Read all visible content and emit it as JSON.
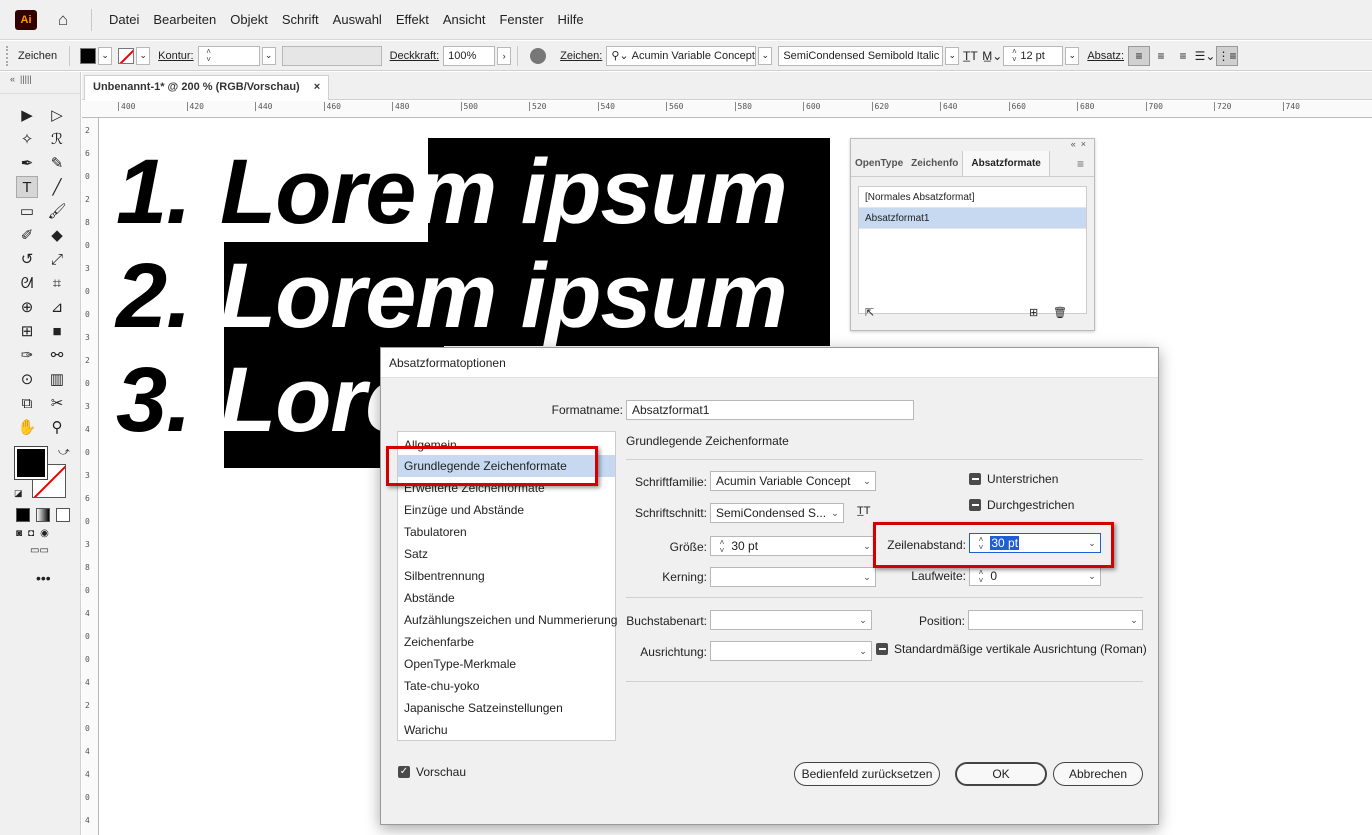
{
  "app": {
    "logo": "Ai",
    "menu": [
      "Datei",
      "Bearbeiten",
      "Objekt",
      "Schrift",
      "Auswahl",
      "Effekt",
      "Ansicht",
      "Fenster",
      "Hilfe"
    ]
  },
  "controlbar": {
    "mode_label": "Zeichen",
    "kontur_label": "Kontur:",
    "deckkraft_label": "Deckkraft:",
    "deckkraft_value": "100%",
    "zeichen_label": "Zeichen:",
    "font_family": "Acumin Variable Concept",
    "font_style": "SemiCondensed Semibold Italic",
    "size_value": "12 pt",
    "absatz_label": "Absatz:"
  },
  "document": {
    "tab_title": "Unbenannt-1* @ 200 % (RGB/Vorschau)",
    "close": "×"
  },
  "ruler": {
    "h_ticks": [
      "400",
      "420",
      "440",
      "460",
      "480",
      "500",
      "520",
      "540",
      "560",
      "580",
      "600",
      "620",
      "640",
      "660",
      "680",
      "700",
      "720",
      "740"
    ],
    "v_ticks": [
      "2",
      "6",
      "0",
      "2",
      "8",
      "0",
      "3",
      "0",
      "0",
      "3",
      "2",
      "0",
      "3",
      "4",
      "0",
      "3",
      "6",
      "0",
      "3",
      "8",
      "0",
      "4",
      "0",
      "0",
      "4",
      "2",
      "0",
      "4",
      "4",
      "0",
      "4"
    ]
  },
  "artwork": {
    "lines": [
      {
        "num": "1.",
        "text_dark": "Lore",
        "text_light": "m ipsum"
      },
      {
        "num": "2.",
        "text_light": "Lorem ipsum"
      },
      {
        "num": "3.",
        "text_light": "Lore"
      }
    ]
  },
  "panel": {
    "tabs": [
      "OpenType",
      "Zeichenfo",
      "Absatzformate"
    ],
    "active_tab": "Absatzformate",
    "styles": [
      "[Normales Absatzformat]",
      "Absatzformat1"
    ],
    "selected_style": "Absatzformat1"
  },
  "dialog": {
    "title": "Absatzformatoptionen",
    "formatname_label": "Formatname:",
    "formatname_value": "Absatzformat1",
    "section_title": "Grundlegende Zeichenformate",
    "nav_items": [
      "Allgemein",
      "Grundlegende Zeichenformate",
      "Erweiterte Zeichenformate",
      "Einzüge und Abstände",
      "Tabulatoren",
      "Satz",
      "Silbentrennung",
      "Abstände",
      "Aufzählungszeichen und Nummerierung",
      "Zeichenfarbe",
      "OpenType-Merkmale",
      "Tate-chu-yoko",
      "Japanische Satzeinstellungen",
      "Warichu"
    ],
    "selected_nav": "Grundlegende Zeichenformate",
    "schriftfamilie_label": "Schriftfamilie:",
    "schriftfamilie_value": "Acumin Variable Concept",
    "schriftschnitt_label": "Schriftschnitt:",
    "schriftschnitt_value": "SemiCondensed S...",
    "groesse_label": "Größe:",
    "groesse_value": "30 pt",
    "kerning_label": "Kerning:",
    "kerning_value": "",
    "zeilenabstand_label": "Zeilenabstand:",
    "zeilenabstand_value": "30 pt",
    "laufweite_label": "Laufweite:",
    "laufweite_value": "0",
    "unterstrichen_label": "Unterstrichen",
    "durchgestrichen_label": "Durchgestrichen",
    "buchstabenart_label": "Buchstabenart:",
    "position_label": "Position:",
    "ausrichtung_label": "Ausrichtung:",
    "roman_label": "Standardmäßige vertikale Ausrichtung (Roman)",
    "vorschau_label": "Vorschau",
    "reset_button": "Bedienfeld zurücksetzen",
    "ok_button": "OK",
    "cancel_button": "Abbrechen"
  },
  "colors": {
    "highlight": "#d40000",
    "selection": "#c6d9f1",
    "text_selection": "#1e5fd6"
  }
}
